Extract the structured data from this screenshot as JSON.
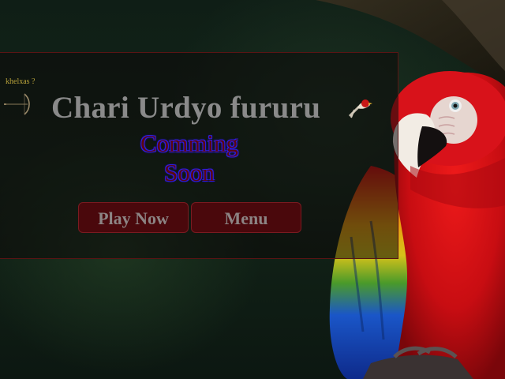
{
  "panel": {
    "tag": "khelxas ?",
    "title": "Chari Urdyo fururu",
    "status_line1": "Comming",
    "status_line2": "Soon"
  },
  "buttons": {
    "play": "Play Now",
    "menu": "Menu"
  },
  "icons": {
    "bow": "bow-and-arrow-icon",
    "bird": "small-bird-icon"
  },
  "colors": {
    "panel_border": "#5a1414",
    "button_fill": "#4a080c",
    "status_text": "#5a0810",
    "status_outline": "#2d1ce0",
    "title_text": "#8a8a8a",
    "tag_text": "#b7a13a"
  }
}
